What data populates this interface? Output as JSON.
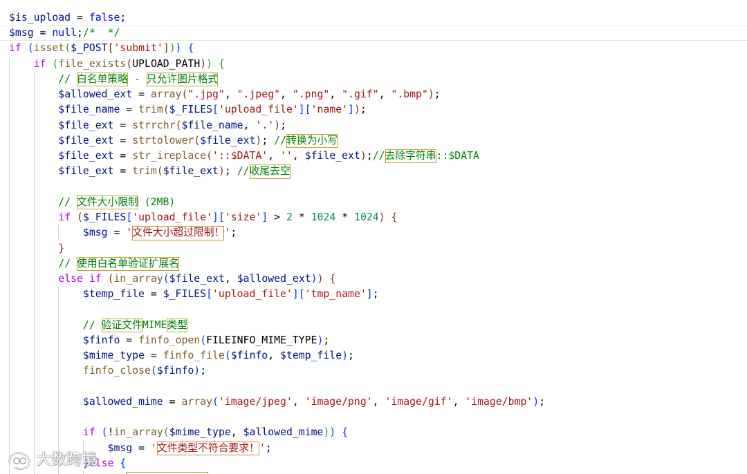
{
  "theme": {
    "background": "#ffffff",
    "keyword": "#AF00DB",
    "variable": "#001080",
    "string": "#A31515",
    "comment": "#008000",
    "function": "#795E26",
    "number": "#098658",
    "literal": "#0000FF",
    "constant": "#000000",
    "operator": "#000000",
    "brackets": [
      "#0431FA",
      "#319331",
      "#7B3814"
    ],
    "indent_guide": "#D6D6D6",
    "unicode_box_comment": "#C2A42B",
    "unicode_box_string": "#D08A36",
    "current_line_border": "#E6E6E6"
  },
  "editor": {
    "current_line_index": 1,
    "lines": [
      [
        [
          "var",
          "$is_upload"
        ],
        [
          "op",
          " = "
        ],
        [
          "lit",
          "false"
        ],
        [
          "op",
          ";"
        ]
      ],
      [
        [
          "var",
          "$msg"
        ],
        [
          "op",
          " = "
        ],
        [
          "lit",
          "null"
        ],
        [
          "op",
          ";"
        ],
        [
          "com",
          "/*  */"
        ]
      ],
      [
        [
          "kw",
          "if"
        ],
        [
          "op",
          " "
        ],
        [
          "br",
          "("
        ],
        [
          "fn",
          "isset"
        ],
        [
          "br",
          "("
        ],
        [
          "var",
          "$_POST"
        ],
        [
          "br",
          "["
        ],
        [
          "str",
          "'submit'"
        ],
        [
          "br",
          "]"
        ],
        [
          "br",
          ")"
        ],
        [
          "br",
          ")"
        ],
        [
          "op",
          " "
        ],
        [
          "br",
          "{"
        ]
      ],
      [
        [
          "ws",
          "    "
        ],
        [
          "kw",
          "if"
        ],
        [
          "op",
          " "
        ],
        [
          "br",
          "("
        ],
        [
          "fn",
          "file_exists"
        ],
        [
          "br",
          "("
        ],
        [
          "const",
          "UPLOAD_PATH"
        ],
        [
          "br",
          ")"
        ],
        [
          "br",
          ")"
        ],
        [
          "op",
          " "
        ],
        [
          "br",
          "{"
        ]
      ],
      [
        [
          "ws",
          "        "
        ],
        [
          "com",
          "// "
        ],
        [
          "com",
          "白名单策略"
        ],
        [
          "com",
          " - "
        ],
        [
          "com",
          "只允许图片格式"
        ]
      ],
      [
        [
          "ws",
          "        "
        ],
        [
          "var",
          "$allowed_ext"
        ],
        [
          "op",
          " = "
        ],
        [
          "fn",
          "array"
        ],
        [
          "br",
          "("
        ],
        [
          "str",
          "\".jpg\""
        ],
        [
          "op",
          ", "
        ],
        [
          "str",
          "\".jpeg\""
        ],
        [
          "op",
          ", "
        ],
        [
          "str",
          "\".png\""
        ],
        [
          "op",
          ", "
        ],
        [
          "str",
          "\".gif\""
        ],
        [
          "op",
          ", "
        ],
        [
          "str",
          "\".bmp\""
        ],
        [
          "br",
          ")"
        ],
        [
          "op",
          ";"
        ]
      ],
      [
        [
          "ws",
          "        "
        ],
        [
          "var",
          "$file_name"
        ],
        [
          "op",
          " = "
        ],
        [
          "fn",
          "trim"
        ],
        [
          "br",
          "("
        ],
        [
          "var",
          "$_FILES"
        ],
        [
          "br",
          "["
        ],
        [
          "str",
          "'upload_file'"
        ],
        [
          "br",
          "]"
        ],
        [
          "br",
          "["
        ],
        [
          "str",
          "'name'"
        ],
        [
          "br",
          "]"
        ],
        [
          "br",
          ")"
        ],
        [
          "op",
          ";"
        ]
      ],
      [
        [
          "ws",
          "        "
        ],
        [
          "var",
          "$file_ext"
        ],
        [
          "op",
          " = "
        ],
        [
          "fn",
          "strrchr"
        ],
        [
          "br",
          "("
        ],
        [
          "var",
          "$file_name"
        ],
        [
          "op",
          ", "
        ],
        [
          "str",
          "'.'"
        ],
        [
          "br",
          ")"
        ],
        [
          "op",
          ";"
        ]
      ],
      [
        [
          "ws",
          "        "
        ],
        [
          "var",
          "$file_ext"
        ],
        [
          "op",
          " = "
        ],
        [
          "fn",
          "strtolower"
        ],
        [
          "br",
          "("
        ],
        [
          "var",
          "$file_ext"
        ],
        [
          "br",
          ")"
        ],
        [
          "op",
          "; "
        ],
        [
          "com",
          "//"
        ],
        [
          "com",
          "转换为小写"
        ]
      ],
      [
        [
          "ws",
          "        "
        ],
        [
          "var",
          "$file_ext"
        ],
        [
          "op",
          " = "
        ],
        [
          "fn",
          "str_ireplace"
        ],
        [
          "br",
          "("
        ],
        [
          "str",
          "'::$DATA'"
        ],
        [
          "op",
          ", "
        ],
        [
          "str",
          "''"
        ],
        [
          "op",
          ", "
        ],
        [
          "var",
          "$file_ext"
        ],
        [
          "br",
          ")"
        ],
        [
          "op",
          ";"
        ],
        [
          "com",
          "//"
        ],
        [
          "com",
          "去除字符串"
        ],
        [
          "com",
          "::$DATA"
        ]
      ],
      [
        [
          "ws",
          "        "
        ],
        [
          "var",
          "$file_ext"
        ],
        [
          "op",
          " = "
        ],
        [
          "fn",
          "trim"
        ],
        [
          "br",
          "("
        ],
        [
          "var",
          "$file_ext"
        ],
        [
          "br",
          ")"
        ],
        [
          "op",
          "; "
        ],
        [
          "com",
          "//"
        ],
        [
          "com",
          "收尾去空"
        ]
      ],
      [],
      [
        [
          "ws",
          "        "
        ],
        [
          "com",
          "// "
        ],
        [
          "com",
          "文件大小限制"
        ],
        [
          "com",
          " (2MB)"
        ]
      ],
      [
        [
          "ws",
          "        "
        ],
        [
          "kw",
          "if"
        ],
        [
          "op",
          " "
        ],
        [
          "br",
          "("
        ],
        [
          "var",
          "$_FILES"
        ],
        [
          "br",
          "["
        ],
        [
          "str",
          "'upload_file'"
        ],
        [
          "br",
          "]"
        ],
        [
          "br",
          "["
        ],
        [
          "str",
          "'size'"
        ],
        [
          "br",
          "]"
        ],
        [
          "op",
          " > "
        ],
        [
          "num",
          "2"
        ],
        [
          "op",
          " * "
        ],
        [
          "num",
          "1024"
        ],
        [
          "op",
          " * "
        ],
        [
          "num",
          "1024"
        ],
        [
          "br",
          ")"
        ],
        [
          "op",
          " "
        ],
        [
          "br",
          "{"
        ]
      ],
      [
        [
          "ws",
          "            "
        ],
        [
          "var",
          "$msg"
        ],
        [
          "op",
          " = "
        ],
        [
          "str",
          "'"
        ],
        [
          "str",
          "文件大小超过限制！"
        ],
        [
          "str",
          "'"
        ],
        [
          "op",
          ";"
        ]
      ],
      [
        [
          "ws",
          "        "
        ],
        [
          "br",
          "}"
        ]
      ],
      [
        [
          "ws",
          "        "
        ],
        [
          "com",
          "// "
        ],
        [
          "com",
          "使用白名单验证扩展名"
        ]
      ],
      [
        [
          "ws",
          "        "
        ],
        [
          "kw",
          "else"
        ],
        [
          "op",
          " "
        ],
        [
          "kw",
          "if"
        ],
        [
          "op",
          " "
        ],
        [
          "br",
          "("
        ],
        [
          "fn",
          "in_array"
        ],
        [
          "br",
          "("
        ],
        [
          "var",
          "$file_ext"
        ],
        [
          "op",
          ", "
        ],
        [
          "var",
          "$allowed_ext"
        ],
        [
          "br",
          ")"
        ],
        [
          "br",
          ")"
        ],
        [
          "op",
          " "
        ],
        [
          "br",
          "{"
        ]
      ],
      [
        [
          "ws",
          "            "
        ],
        [
          "var",
          "$temp_file"
        ],
        [
          "op",
          " = "
        ],
        [
          "var",
          "$_FILES"
        ],
        [
          "br",
          "["
        ],
        [
          "str",
          "'upload_file'"
        ],
        [
          "br",
          "]"
        ],
        [
          "br",
          "["
        ],
        [
          "str",
          "'tmp_name'"
        ],
        [
          "br",
          "]"
        ],
        [
          "op",
          ";"
        ]
      ],
      [],
      [
        [
          "ws",
          "            "
        ],
        [
          "com",
          "// "
        ],
        [
          "com",
          "验证文件"
        ],
        [
          "com",
          "MIME"
        ],
        [
          "com",
          "类型"
        ]
      ],
      [
        [
          "ws",
          "            "
        ],
        [
          "var",
          "$finfo"
        ],
        [
          "op",
          " = "
        ],
        [
          "fn",
          "finfo_open"
        ],
        [
          "br",
          "("
        ],
        [
          "const",
          "FILEINFO_MIME_TYPE"
        ],
        [
          "br",
          ")"
        ],
        [
          "op",
          ";"
        ]
      ],
      [
        [
          "ws",
          "            "
        ],
        [
          "var",
          "$mime_type"
        ],
        [
          "op",
          " = "
        ],
        [
          "fn",
          "finfo_file"
        ],
        [
          "br",
          "("
        ],
        [
          "var",
          "$finfo"
        ],
        [
          "op",
          ", "
        ],
        [
          "var",
          "$temp_file"
        ],
        [
          "br",
          ")"
        ],
        [
          "op",
          ";"
        ]
      ],
      [
        [
          "ws",
          "            "
        ],
        [
          "fn",
          "finfo_close"
        ],
        [
          "br",
          "("
        ],
        [
          "var",
          "$finfo"
        ],
        [
          "br",
          ")"
        ],
        [
          "op",
          ";"
        ]
      ],
      [],
      [
        [
          "ws",
          "            "
        ],
        [
          "var",
          "$allowed_mime"
        ],
        [
          "op",
          " = "
        ],
        [
          "fn",
          "array"
        ],
        [
          "br",
          "("
        ],
        [
          "str",
          "'image/jpeg'"
        ],
        [
          "op",
          ", "
        ],
        [
          "str",
          "'image/png'"
        ],
        [
          "op",
          ", "
        ],
        [
          "str",
          "'image/gif'"
        ],
        [
          "op",
          ", "
        ],
        [
          "str",
          "'image/bmp'"
        ],
        [
          "br",
          ")"
        ],
        [
          "op",
          ";"
        ]
      ],
      [],
      [
        [
          "ws",
          "            "
        ],
        [
          "kw",
          "if"
        ],
        [
          "op",
          " "
        ],
        [
          "br",
          "("
        ],
        [
          "op",
          "!"
        ],
        [
          "fn",
          "in_array"
        ],
        [
          "br",
          "("
        ],
        [
          "var",
          "$mime_type"
        ],
        [
          "op",
          ", "
        ],
        [
          "var",
          "$allowed_mime"
        ],
        [
          "br",
          ")"
        ],
        [
          "br",
          ")"
        ],
        [
          "op",
          " "
        ],
        [
          "br",
          "{"
        ]
      ],
      [
        [
          "ws",
          "                "
        ],
        [
          "var",
          "$msg"
        ],
        [
          "op",
          " = "
        ],
        [
          "str",
          "'"
        ],
        [
          "str",
          "文件类型不符合要求！"
        ],
        [
          "str",
          "'"
        ],
        [
          "op",
          ";"
        ]
      ],
      [
        [
          "ws",
          "            "
        ],
        [
          "br",
          "}"
        ],
        [
          "kw",
          "else"
        ],
        [
          "op",
          " "
        ],
        [
          "br",
          "{"
        ]
      ]
    ]
  },
  "watermark": {
    "text": "大数跨境",
    "logo_icon": "loop-logo-icon"
  }
}
